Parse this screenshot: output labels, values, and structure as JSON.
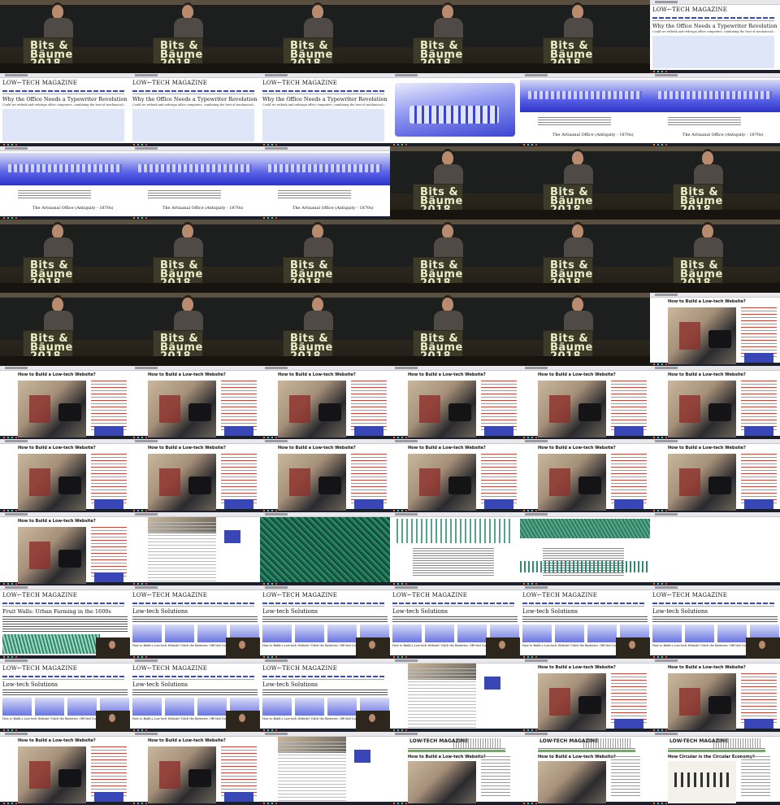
{
  "talk": {
    "logo_line1": "Bits &",
    "logo_line2": "Bäume",
    "logo_line3": "2018"
  },
  "magazine": {
    "masthead": "LOW←TECH MAGAZINE",
    "masthead_alt": "LOW-TECH MAGAZINE"
  },
  "articles": {
    "typewriter_title": "Why the Office Needs a Typewriter Revolution",
    "typewriter_subtitle": "Could we rethink and redesign office computers, combining the best of mechanical and digital devices?",
    "typewriter_caption": "The Artisanal Office (Antiquity - 1870s)",
    "website_title": "How to Build a Low-tech Website?",
    "fruit_walls_title": "Fruit Walls: Urban Farming in the 1600s",
    "solutions_title": "Low-tech Solutions",
    "solutions_thumbs": "How to Build a Low-tech Website?   Ditch the Batteries: Off-Grid Compressed Air   How Much Energy Do We Need?",
    "circular_title": "How Circular is the Circular Economy?"
  },
  "frames": [
    {
      "kind": "talk"
    },
    {
      "kind": "talk"
    },
    {
      "kind": "talk"
    },
    {
      "kind": "talk"
    },
    {
      "kind": "talk"
    },
    {
      "kind": "mag-article"
    },
    {
      "kind": "mag-article"
    },
    {
      "kind": "mag-article"
    },
    {
      "kind": "mag-article"
    },
    {
      "kind": "tw-zoom"
    },
    {
      "kind": "tw-figure"
    },
    {
      "kind": "tw-figure"
    },
    {
      "kind": "tw-figure"
    },
    {
      "kind": "tw-figure"
    },
    {
      "kind": "tw-figure"
    },
    {
      "kind": "talk"
    },
    {
      "kind": "talk"
    },
    {
      "kind": "talk"
    },
    {
      "kind": "talk"
    },
    {
      "kind": "talk"
    },
    {
      "kind": "talk"
    },
    {
      "kind": "talk"
    },
    {
      "kind": "talk"
    },
    {
      "kind": "talk"
    },
    {
      "kind": "talk"
    },
    {
      "kind": "talk"
    },
    {
      "kind": "talk"
    },
    {
      "kind": "talk"
    },
    {
      "kind": "talk"
    },
    {
      "kind": "lowtech-site"
    },
    {
      "kind": "lowtech-site"
    },
    {
      "kind": "lowtech-site"
    },
    {
      "kind": "lowtech-site"
    },
    {
      "kind": "lowtech-site"
    },
    {
      "kind": "lowtech-site"
    },
    {
      "kind": "lowtech-site"
    },
    {
      "kind": "lowtech-site"
    },
    {
      "kind": "lowtech-site"
    },
    {
      "kind": "lowtech-site"
    },
    {
      "kind": "lowtech-site"
    },
    {
      "kind": "lowtech-site"
    },
    {
      "kind": "lowtech-site"
    },
    {
      "kind": "lowtech-site"
    },
    {
      "kind": "webpage-white"
    },
    {
      "kind": "green-grain"
    },
    {
      "kind": "green-illus"
    },
    {
      "kind": "green-band"
    },
    {
      "kind": "blank"
    },
    {
      "kind": "fruit-walls"
    },
    {
      "kind": "solutions"
    },
    {
      "kind": "solutions"
    },
    {
      "kind": "solutions"
    },
    {
      "kind": "solutions"
    },
    {
      "kind": "solutions"
    },
    {
      "kind": "solutions"
    },
    {
      "kind": "solutions"
    },
    {
      "kind": "solutions"
    },
    {
      "kind": "webpage-white"
    },
    {
      "kind": "lowtech-site"
    },
    {
      "kind": "lowtech-site"
    },
    {
      "kind": "lowtech-site"
    },
    {
      "kind": "lowtech-site"
    },
    {
      "kind": "webpage-white"
    },
    {
      "kind": "ltm-site"
    },
    {
      "kind": "ltm-site"
    },
    {
      "kind": "ltm-circular"
    }
  ]
}
